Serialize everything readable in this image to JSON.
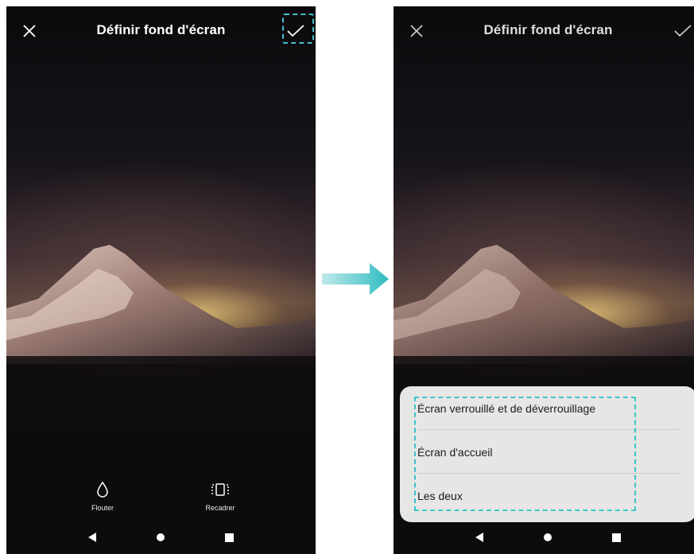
{
  "left_screen": {
    "title": "Définir fond d'écran",
    "close_icon": "close-icon",
    "confirm_icon": "check-icon",
    "tools": [
      {
        "label": "Flouter",
        "icon": "blur-drop-icon"
      },
      {
        "label": "Recadrer",
        "icon": "crop-icon"
      }
    ]
  },
  "right_screen": {
    "title": "Définir fond d'écran",
    "close_icon": "close-icon",
    "confirm_icon": "check-icon",
    "options": [
      {
        "label": "Écran verrouillé et de déverrouillage"
      },
      {
        "label": "Écran d'accueil"
      },
      {
        "label": "Les deux"
      }
    ]
  },
  "navbar": {
    "back_icon": "back-triangle-icon",
    "home_icon": "home-circle-icon",
    "recent_icon": "recent-square-icon"
  },
  "colors": {
    "highlight": "#3cc4c8",
    "sheet": "#e6e6e6"
  }
}
